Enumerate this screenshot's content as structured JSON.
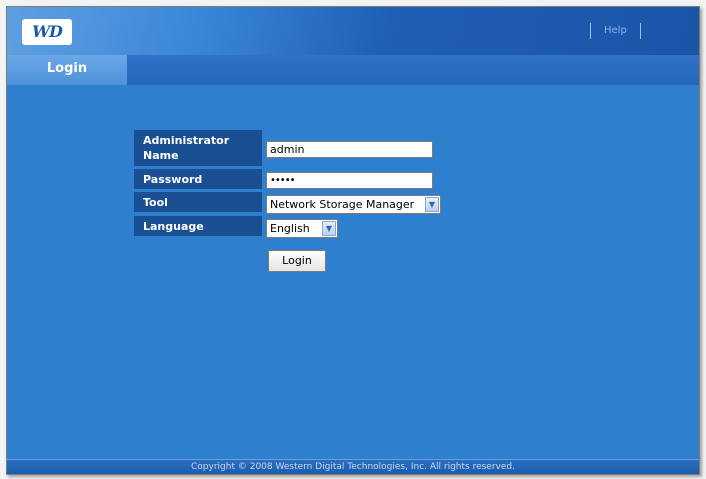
{
  "brand": {
    "logo_text": "WD"
  },
  "header": {
    "help_label": "Help"
  },
  "tabs": [
    {
      "label": "Login"
    }
  ],
  "form": {
    "admin_label": "Administrator Name",
    "admin_value": "admin",
    "password_label": "Password",
    "password_value": "•••••",
    "tool_label": "Tool",
    "tool_value": "Network Storage Manager",
    "language_label": "Language",
    "language_value": "English",
    "login_button": "Login"
  },
  "footer": {
    "copyright": "Copyright © 2008 Western Digital Technologies, Inc. All rights reserved."
  },
  "colors": {
    "background": "#2f7fcf",
    "label_bg": "#1b4f93",
    "header": "#1f5fb6"
  }
}
